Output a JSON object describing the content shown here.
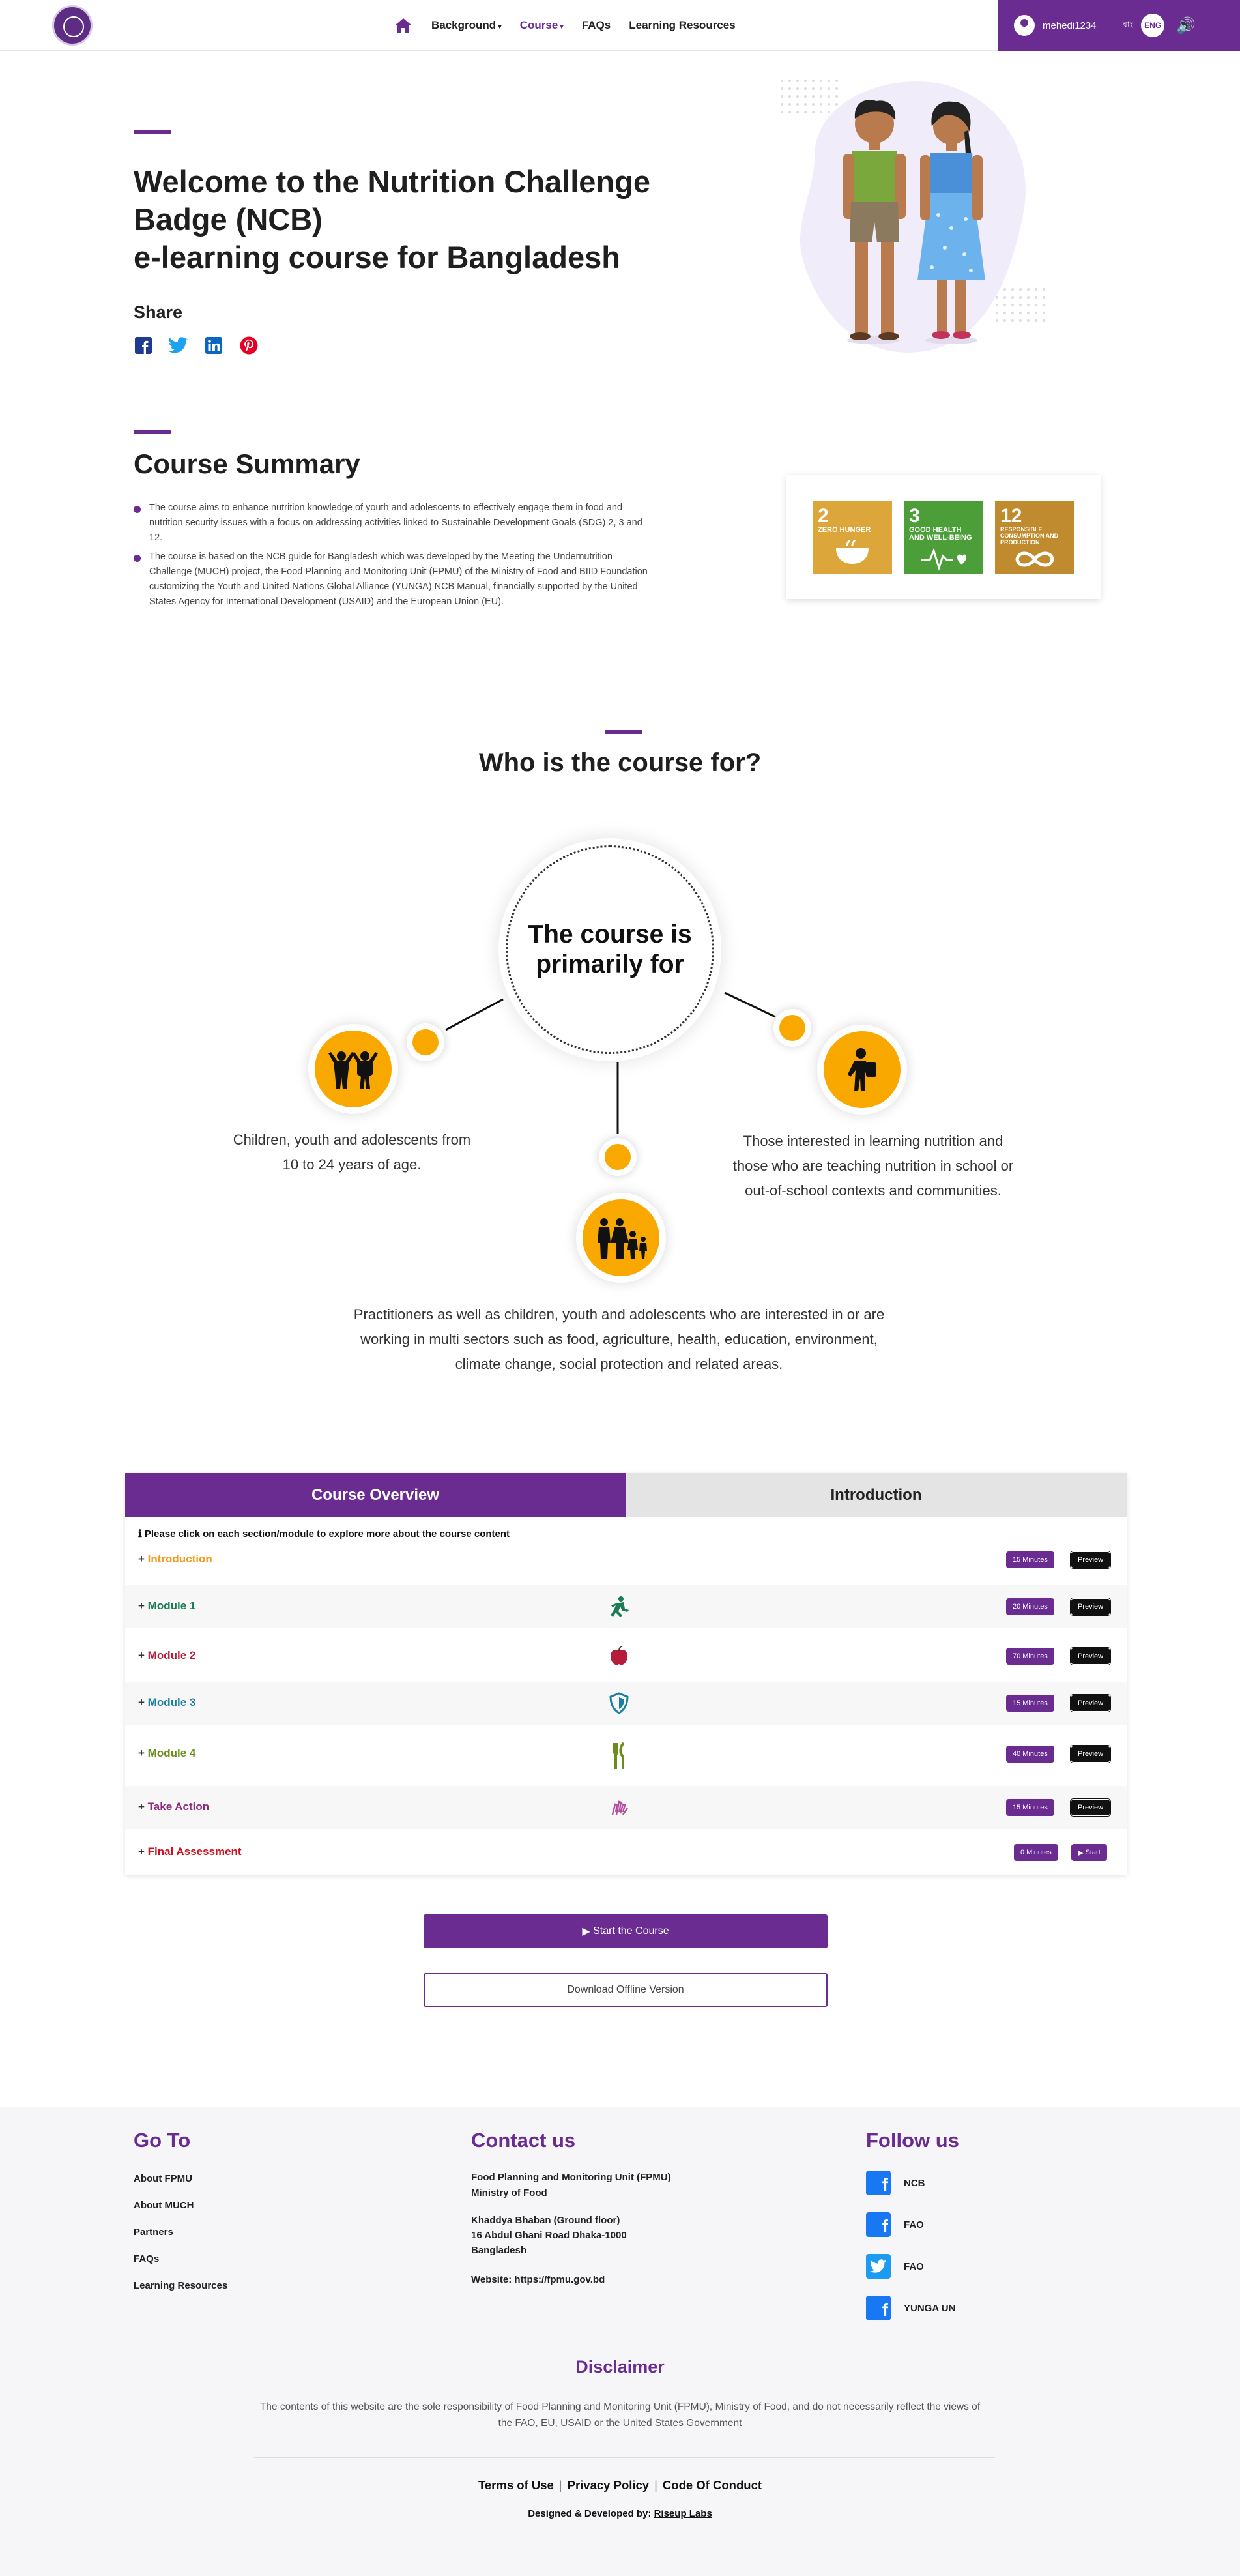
{
  "header": {
    "nav": [
      {
        "label": "Background"
      },
      {
        "label": "Course"
      },
      {
        "label": "FAQs"
      },
      {
        "label": "Learning Resources"
      }
    ],
    "user_name": "mehedi1234",
    "lang_bn": "বাং",
    "lang_en": "ENG"
  },
  "hero": {
    "title_line1": "Welcome to the Nutrition Challenge",
    "title_line2": "Badge (NCB)",
    "title_line3": "e-learning course for Bangladesh",
    "share_label": "Share"
  },
  "summary": {
    "title": "Course Summary",
    "items": [
      "The course aims to enhance nutrition knowledge of youth and adolescents to effectively engage them in food and nutrition security issues with a focus on addressing activities linked to Sustainable Development Goals (SDG) 2, 3 and 12.",
      "The course is based on the NCB guide for Bangladesh which was developed by the Meeting the Undernutrition Challenge (MUCH) project, the Food Planning and Monitoring Unit (FPMU) of the Ministry of Food and BIID Foundation customizing the Youth and United Nations Global Alliance (YUNGA) NCB Manual, financially supported by the United States Agency for International Development (USAID) and the European Union (EU)."
    ],
    "sdgs": [
      {
        "num": "2",
        "label": "ZERO HUNGER",
        "color": "#dda63a"
      },
      {
        "num": "3",
        "label": "GOOD HEALTH AND WELL-BEING",
        "color": "#4c9f38"
      },
      {
        "num": "12",
        "label": "RESPONSIBLE CONSUMPTION AND PRODUCTION",
        "color": "#bf8b2e"
      }
    ]
  },
  "who": {
    "title": "Who is the course for?",
    "center_line1": "The course is",
    "center_line2": "primarily for",
    "left_line1": "Children, youth and adolescents from",
    "left_line2": "10 to 24 years of age.",
    "right_line1": "Those interested in learning nutrition and",
    "right_line2": "those who are teaching nutrition in school or",
    "right_line3": "out-of-school contexts and communities.",
    "bottom_line1": "Practitioners as well as children, youth and adolescents who are interested in or are",
    "bottom_line2": "working in multi sectors  such as food, agriculture, health, education, environment,",
    "bottom_line3": "climate change,  social protection and related areas."
  },
  "course": {
    "tab_overview": "Course Overview",
    "tab_intro": "Introduction",
    "note": "Please click on each section/module to explore more about the course content",
    "modules": [
      {
        "label": "Introduction",
        "color": "#f29b1d",
        "duration": "15 Minutes",
        "action": "Preview"
      },
      {
        "label": "Module 1",
        "color": "#1c7d54",
        "duration": "20 Minutes",
        "action": "Preview"
      },
      {
        "label": "Module 2",
        "color": "#b51d3a",
        "duration": "70 Minutes",
        "action": "Preview"
      },
      {
        "label": "Module 3",
        "color": "#1a7fa0",
        "duration": "15 Minutes",
        "action": "Preview"
      },
      {
        "label": "Module 4",
        "color": "#6a8d1a",
        "duration": "40 Minutes",
        "action": "Preview"
      },
      {
        "label": "Take Action",
        "color": "#8e2a7f",
        "duration": "15 Minutes",
        "action": "Preview"
      },
      {
        "label": "Final Assessment",
        "color": "#d0101f",
        "duration": "0 Minutes",
        "action": "Start"
      }
    ],
    "start_button": "Start the Course",
    "download_button": "Download Offline Version"
  },
  "footer": {
    "goto_title": "Go To",
    "goto_links": [
      "About FPMU",
      "About MUCH",
      "Partners",
      "FAQs",
      "Learning Resources"
    ],
    "contact_title": "Contact us",
    "contact_org1": "Food Planning and Monitoring Unit (FPMU)",
    "contact_org2": "Ministry of Food",
    "contact_addr1": "Khaddya Bhaban (Ground floor)",
    "contact_addr2": "16 Abdul Ghani Road Dhaka-1000",
    "contact_addr3": "Bangladesh",
    "contact_web": "Website: https://fpmu.gov.bd",
    "follow_title": "Follow us",
    "follow": [
      {
        "label": "NCB",
        "icon": "facebook-icon"
      },
      {
        "label": "FAO",
        "icon": "facebook-icon"
      },
      {
        "label": "FAO",
        "icon": "twitter-icon"
      },
      {
        "label": "YUNGA UN",
        "icon": "facebook-icon"
      }
    ],
    "disclaimer_title": "Disclaimer",
    "disclaimer_text": "The contents of this website are the sole responsibility of Food Planning and Monitoring Unit (FPMU), Ministry of Food, and do not necessarily reflect the views of the FAO, EU, USAID or the United States Government",
    "terms": "Terms of Use",
    "privacy": "Privacy Policy",
    "conduct": "Code Of Conduct",
    "credit_prefix": "Designed & Developed by: ",
    "credit_link": "Riseup Labs"
  }
}
